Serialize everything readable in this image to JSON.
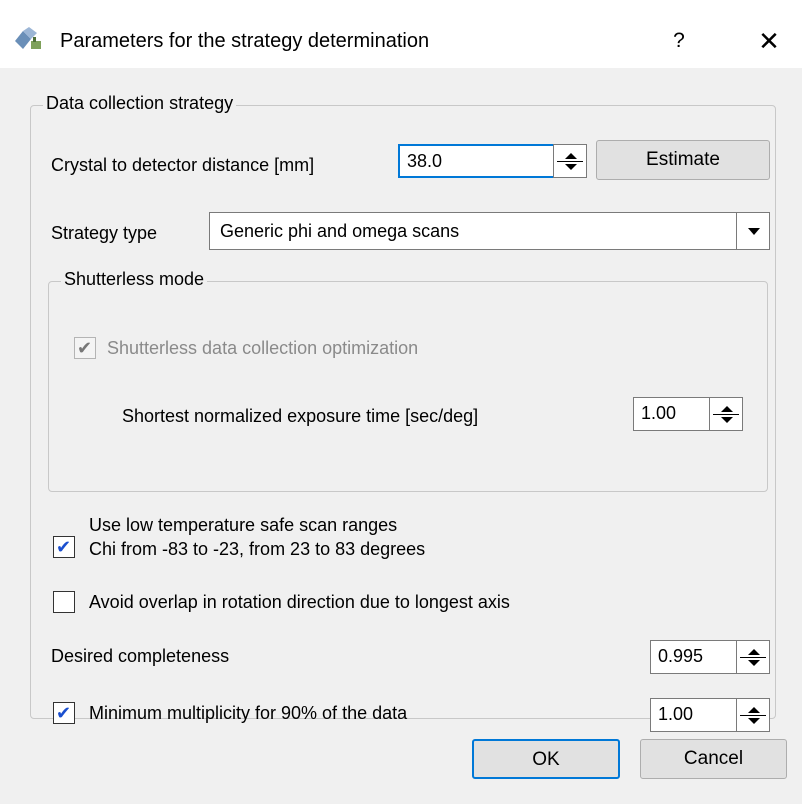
{
  "window": {
    "title": "Parameters for the strategy determination",
    "help_glyph": "?",
    "close_glyph": "✕",
    "icon": "crystal-app-icon"
  },
  "strategy_group": {
    "legend": "Data collection strategy",
    "distance_label": "Crystal to detector distance [mm]",
    "distance_value": "38.0",
    "estimate_label": "Estimate",
    "strategy_type_label": "Strategy type",
    "strategy_type_value": "Generic phi and omega scans"
  },
  "shutterless_group": {
    "legend": "Shutterless mode",
    "optimization_label": "Shutterless data collection optimization",
    "optimization_checked": true,
    "exposure_label": "Shortest normalized exposure time [sec/deg]",
    "exposure_value": "1.00"
  },
  "options": {
    "low_temp_line1": "Use low temperature safe scan ranges",
    "low_temp_line2": "Chi from -83 to -23, from 23 to 83 degrees",
    "low_temp_checked": true,
    "avoid_overlap_label": "Avoid overlap in rotation direction due to longest axis",
    "avoid_overlap_checked": false,
    "completeness_label": "Desired completeness",
    "completeness_value": "0.995",
    "multiplicity_label": "Minimum multiplicity for 90% of the data",
    "multiplicity_checked": true,
    "multiplicity_value": "1.00"
  },
  "footer": {
    "ok_label": "OK",
    "cancel_label": "Cancel"
  },
  "colors": {
    "accent": "#0078d7",
    "check": "#1a4fcf",
    "dialog_bg": "#f0f0f0"
  }
}
